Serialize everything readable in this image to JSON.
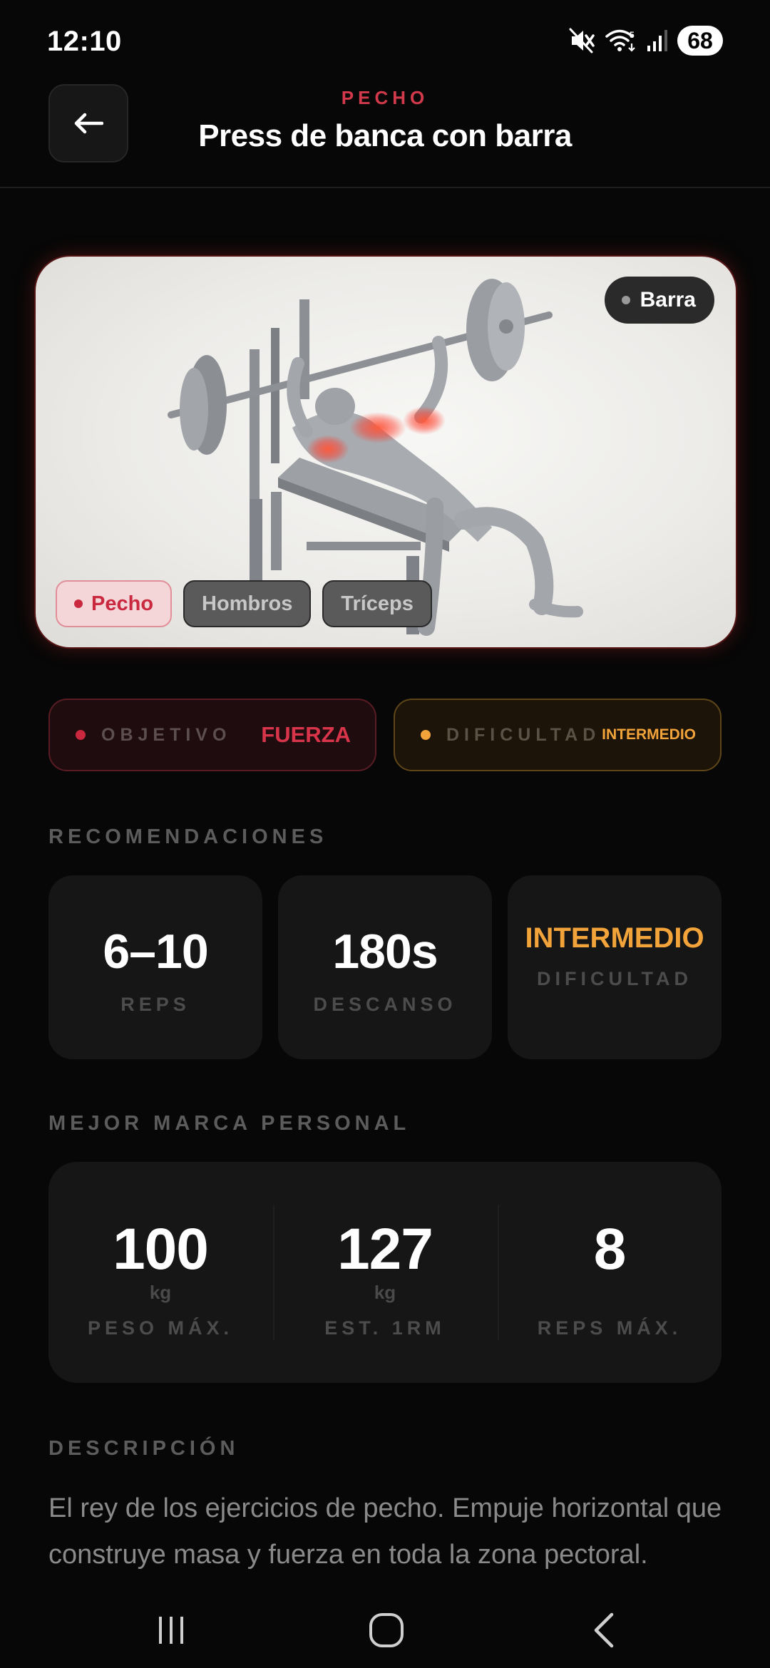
{
  "status_bar": {
    "time": "12:10",
    "battery": "68",
    "icons": [
      "mute-icon",
      "wifi-icon",
      "signal-icon",
      "battery-icon"
    ]
  },
  "header": {
    "category": "PECHO",
    "title": "Press de banca con barra",
    "back_icon": "arrow-left-icon"
  },
  "hero": {
    "equipment": "Barra",
    "muscles": [
      {
        "label": "Pecho",
        "primary": true
      },
      {
        "label": "Hombros",
        "primary": false
      },
      {
        "label": "Tríceps",
        "primary": false
      }
    ]
  },
  "info": {
    "objective_label": "OBJETIVO",
    "objective_value": "FUERZA",
    "difficulty_label": "DIFICULTAD",
    "difficulty_value": "INTERMEDIO"
  },
  "recommendations": {
    "title": "RECOMENDACIONES",
    "cards": [
      {
        "value": "6–10",
        "label": "REPS"
      },
      {
        "value": "180s",
        "label": "DESCANSO"
      },
      {
        "value": "INTERMEDIO",
        "label": "DIFICULTAD"
      }
    ]
  },
  "personal_best": {
    "title": "MEJOR MARCA PERSONAL",
    "stats": [
      {
        "value": "100",
        "unit": "kg",
        "label": "PESO MÁX."
      },
      {
        "value": "127",
        "unit": "kg",
        "label": "EST. 1RM"
      },
      {
        "value": "8",
        "unit": "",
        "label": "REPS MÁX."
      }
    ]
  },
  "description": {
    "title": "DESCRIPCIÓN",
    "text": "El rey de los ejercicios de pecho. Empuje horizontal que construye masa y fuerza en toda la zona pectoral."
  },
  "colors": {
    "accent_red": "#c9283f",
    "accent_orange": "#f2a33a",
    "background": "#070707",
    "card": "#161616"
  }
}
